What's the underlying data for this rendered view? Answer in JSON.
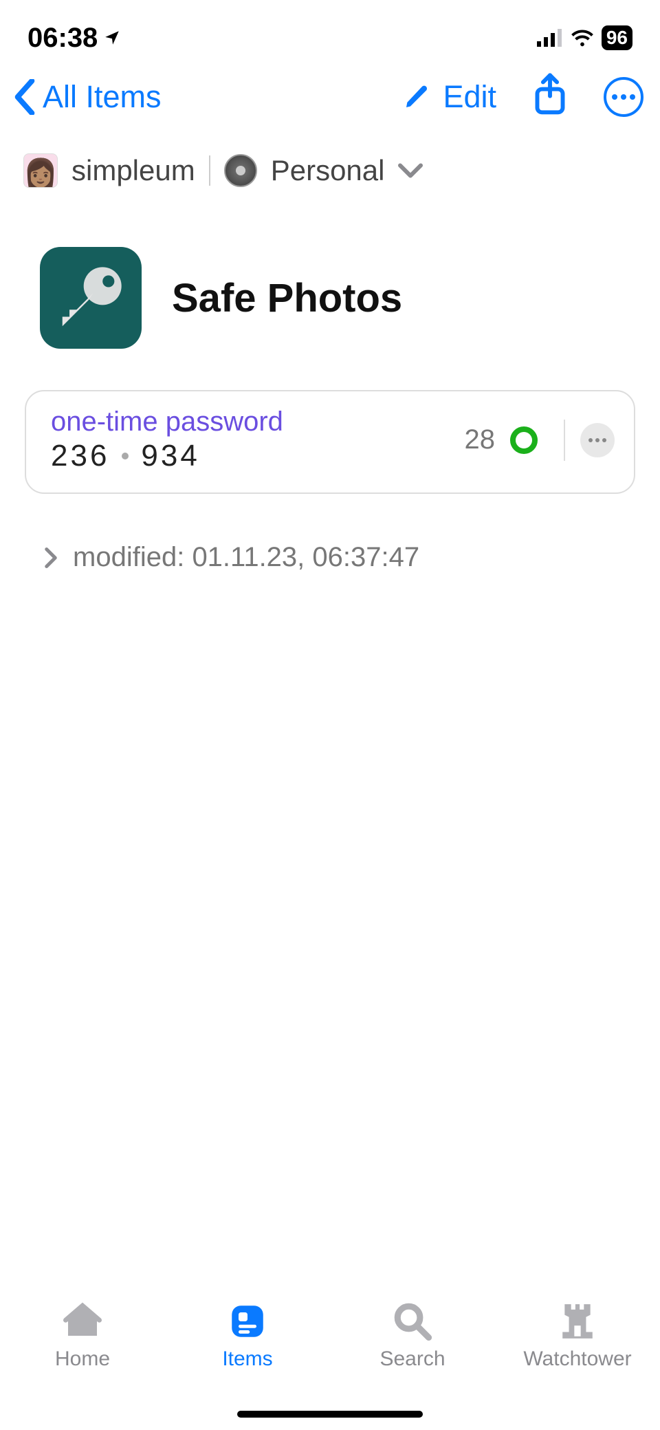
{
  "status": {
    "time": "06:38",
    "battery": "96"
  },
  "nav": {
    "back_label": "All Items",
    "edit_label": "Edit"
  },
  "account": {
    "name": "simpleum",
    "vault": "Personal"
  },
  "item": {
    "title": "Safe Photos"
  },
  "otp": {
    "label": "one-time password",
    "part1": "236",
    "part2": "934",
    "countdown": "28"
  },
  "modified": {
    "prefix": "modified:",
    "timestamp": "01.11.23, 06:37:47"
  },
  "tabs": {
    "home": "Home",
    "items": "Items",
    "search": "Search",
    "watchtower": "Watchtower"
  }
}
